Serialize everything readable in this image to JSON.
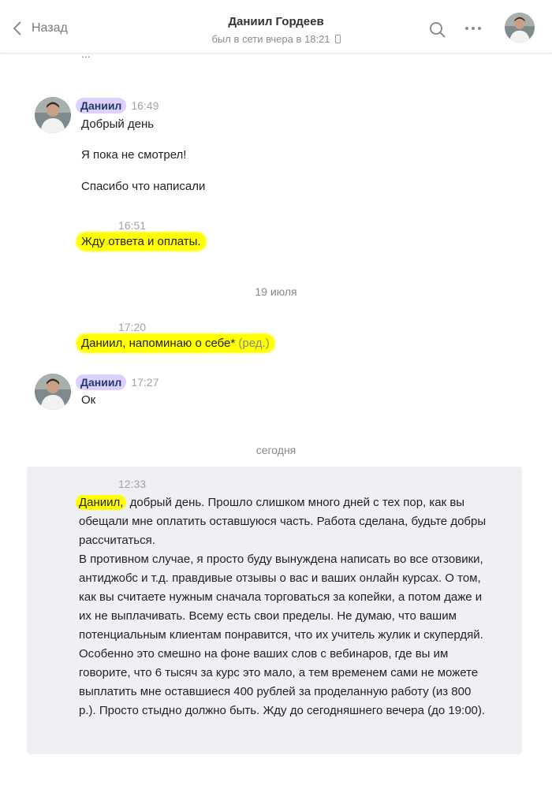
{
  "header": {
    "back_label": "Назад",
    "name": "Даниил Гордеев",
    "status": "был в сети вчера в 18:21"
  },
  "messages": {
    "clipped": "...",
    "m1": {
      "author": "Даниил",
      "time": "16:49",
      "lines": [
        "Добрый день",
        "Я пока не смотрел!",
        "Спасибо что написали"
      ]
    },
    "m2": {
      "time": "16:51",
      "text": "Жду ответа и оплаты."
    },
    "day1": "19 июля",
    "m3": {
      "time": "17:20",
      "text": "Даниил, напоминаю о себе*",
      "edited": "(ред.)"
    },
    "m4": {
      "author": "Даниил",
      "time": "17:27",
      "text": "Ок"
    },
    "day2": "сегодня",
    "m5": {
      "time": "12:33",
      "name_hl": "Даниил,",
      "p1_rest": " добрый день. Прошло слишком много дней с тех пор, как вы обещали мне оплатить оставшуюся часть. Работа сделана, будьте добры рассчитаться.",
      "p2": "В противном случае, я просто буду вынуждена написать во все отзовики, антиджобс и т.д. правдивые отзывы о вас и ваших онлайн курсах. О том, как вы считаете нужным сначала торговаться за копейки, а потом даже и их не выплачивать. Всему есть свои пределы. Не думаю, что вашим потенциальным клиентам понравится, что их учитель жулик и скупердяй. Особенно это смешно на фоне ваших слов с вебинаров, где вы им говорите, что 6 тысяч за курс это мало, а тем временем сами не можете выплатить мне оставшиеся 400 рублей за проделанную работу (из 800 р.). Просто стыдно должно быть. Жду до сегодняшнего вечера (до 19:00)."
    }
  },
  "colors": {
    "highlight_yellow": "#ffff00",
    "name_purple": "#ddd0ff",
    "block_bg": "#eef0f3"
  }
}
